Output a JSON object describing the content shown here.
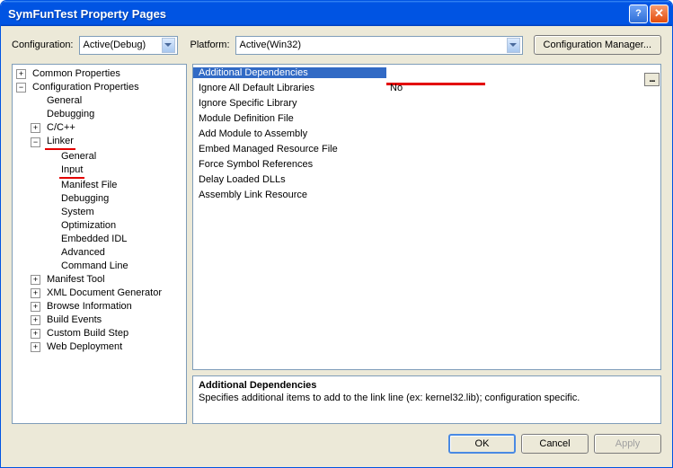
{
  "title": "SymFunTest Property Pages",
  "top": {
    "config_label": "Configuration:",
    "config_value": "Active(Debug)",
    "platform_label": "Platform:",
    "platform_value": "Active(Win32)",
    "config_mgr": "Configuration Manager..."
  },
  "tree": {
    "common": "Common Properties",
    "config_props": "Configuration Properties",
    "general": "General",
    "debugging": "Debugging",
    "ccpp": "C/C++",
    "linker": "Linker",
    "linker_children": {
      "general": "General",
      "input": "Input",
      "manifest": "Manifest File",
      "debugging": "Debugging",
      "system": "System",
      "optimization": "Optimization",
      "embedded_idl": "Embedded IDL",
      "advanced": "Advanced",
      "cmdline": "Command Line"
    },
    "manifest_tool": "Manifest Tool",
    "xml_doc": "XML Document Generator",
    "browse": "Browse Information",
    "build_events": "Build Events",
    "custom_build": "Custom Build Step",
    "web_deploy": "Web Deployment"
  },
  "props": {
    "additional_deps": {
      "name": "Additional Dependencies",
      "val": ""
    },
    "ignore_all": {
      "name": "Ignore All Default Libraries",
      "val": "No"
    },
    "ignore_specific": {
      "name": "Ignore Specific Library",
      "val": ""
    },
    "module_def": {
      "name": "Module Definition File",
      "val": ""
    },
    "add_module": {
      "name": "Add Module to Assembly",
      "val": ""
    },
    "embed_res": {
      "name": "Embed Managed Resource File",
      "val": ""
    },
    "force_sym": {
      "name": "Force Symbol References",
      "val": ""
    },
    "delay_load": {
      "name": "Delay Loaded DLLs",
      "val": ""
    },
    "asm_link": {
      "name": "Assembly Link Resource",
      "val": ""
    }
  },
  "desc": {
    "title": "Additional Dependencies",
    "text": "Specifies additional items to add to the link line (ex: kernel32.lib); configuration specific."
  },
  "buttons": {
    "ok": "OK",
    "cancel": "Cancel",
    "apply": "Apply",
    "ellipsis": "..."
  }
}
